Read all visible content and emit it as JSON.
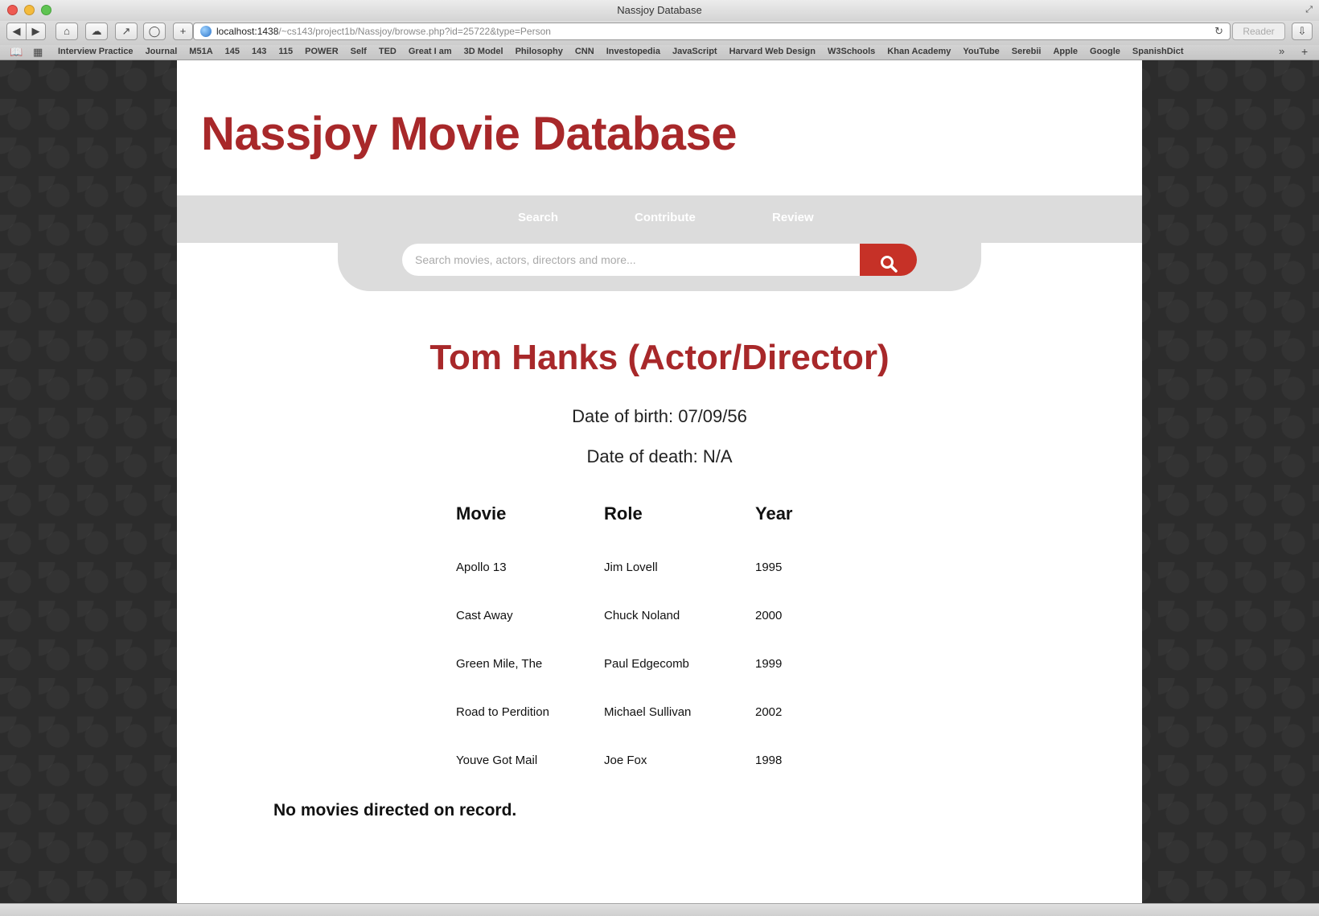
{
  "window": {
    "title": "Nassjoy Database"
  },
  "toolbar": {
    "url_host": "localhost:1438",
    "url_path": "/~cs143/project1b/Nassjoy/browse.php?id=25722&type=Person",
    "reader_label": "Reader"
  },
  "bookmarks": [
    "Interview Practice",
    "Journal",
    "M51A",
    "145",
    "143",
    "115",
    "POWER",
    "Self",
    "TED",
    "Great I am",
    "3D Model",
    "Philosophy",
    "CNN",
    "Investopedia",
    "JavaScript",
    "Harvard Web Design",
    "W3Schools",
    "Khan Academy",
    "YouTube",
    "Serebii",
    "Apple",
    "Google",
    "SpanishDict"
  ],
  "site": {
    "title": "Nassjoy Movie Database"
  },
  "nav": {
    "search": "Search",
    "contribute": "Contribute",
    "review": "Review"
  },
  "search": {
    "placeholder": "Search movies, actors, directors and more..."
  },
  "person": {
    "title": "Tom Hanks (Actor/Director)",
    "dob": "Date of birth: 07/09/56",
    "dod": "Date of death: N/A"
  },
  "table": {
    "headers": [
      "Movie",
      "Role",
      "Year"
    ],
    "rows": [
      [
        "Apollo 13",
        "Jim Lovell",
        "1995"
      ],
      [
        "Cast Away",
        "Chuck Noland",
        "2000"
      ],
      [
        "Green Mile, The",
        "Paul Edgecomb",
        "1999"
      ],
      [
        "Road to Perdition",
        "Michael Sullivan",
        "2002"
      ],
      [
        "Youve Got Mail",
        "Joe Fox",
        "1998"
      ]
    ]
  },
  "directed": {
    "message": "No movies directed on record."
  },
  "colors": {
    "brand_red": "#a8282a",
    "search_button": "#c63127",
    "nav_gray": "#dcdcdc"
  }
}
